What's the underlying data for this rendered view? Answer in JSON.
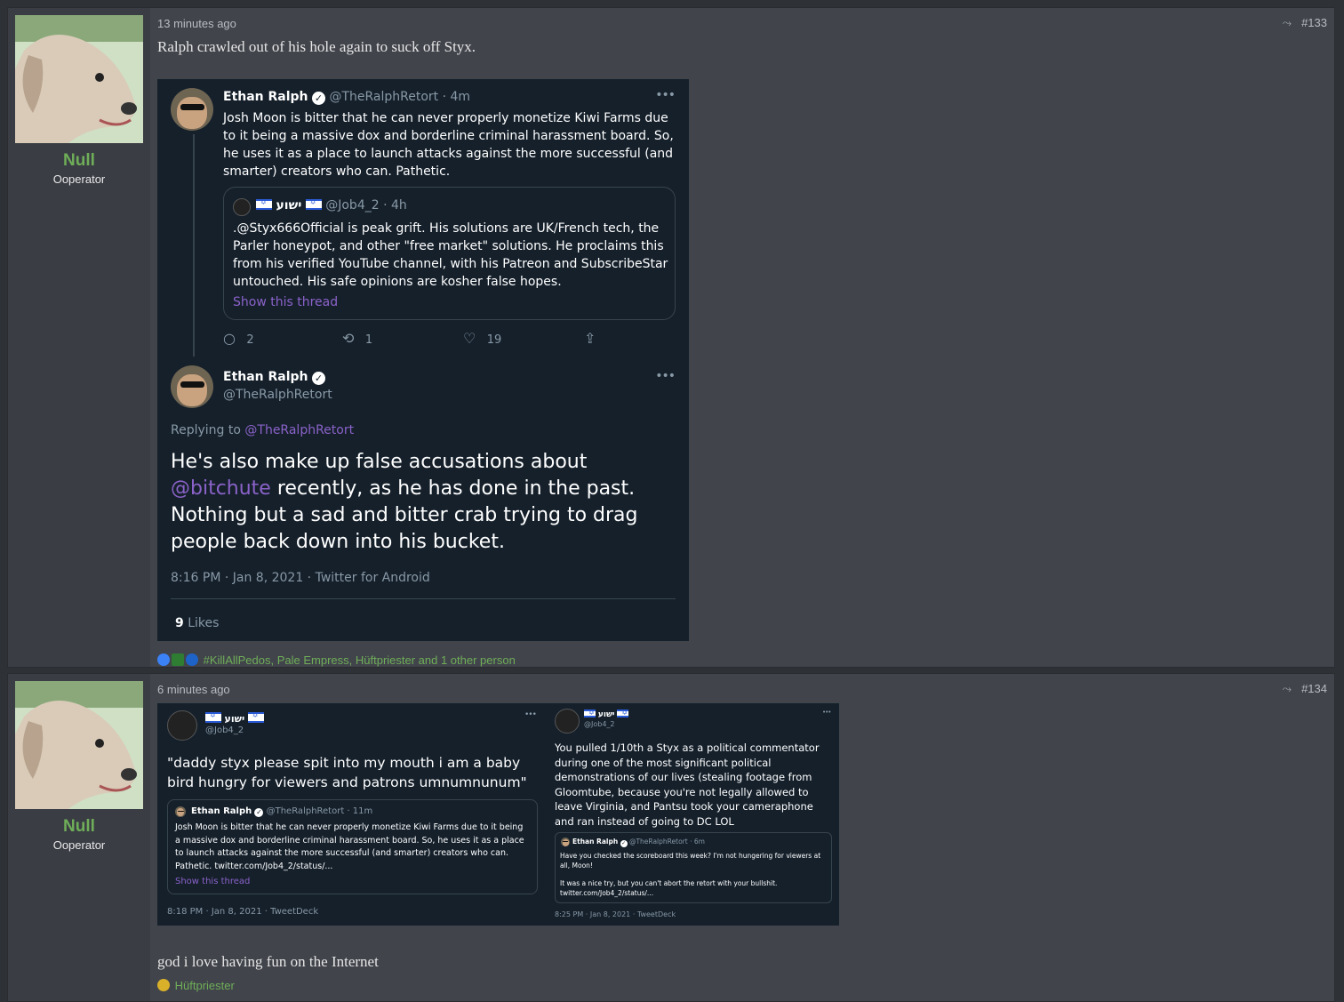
{
  "posts": [
    {
      "user": {
        "name": "Null",
        "title": "Ooperator"
      },
      "time": "13 minutes ago",
      "number": "#133",
      "message": "Ralph crawled out of his hole again to suck off Styx.",
      "tweet": {
        "author": "Ethan Ralph",
        "handle": "@TheRalphRetort",
        "age": "· 4m",
        "text": "Josh Moon is bitter that he can never properly monetize Kiwi Farms due to it being a massive dox and borderline criminal harassment board. So, he uses it as a place to launch attacks against the more successful (and smarter) creators who can. Pathetic.",
        "quote": {
          "name": "ישוע",
          "handle": "@Job4_2",
          "age": "· 4h",
          "text": ".@Styx666Official is peak grift. His solutions are UK/French tech, the Parler honeypot, and other \"free market\" solutions. He proclaims this from his verified YouTube channel, with his Patreon and SubscribeStar untouched. His safe opinions are kosher false hopes.",
          "show_thread": "Show this thread"
        },
        "replies": "2",
        "retweets": "1",
        "likes": "19",
        "reply": {
          "author": "Ethan Ralph",
          "handle": "@TheRalphRetort",
          "replying_label": "Replying to",
          "replying_handle": "@TheRalphRetort",
          "text_before": "He's also make up false accusations about ",
          "mention": "@bitchute",
          "text_after": " recently, as he has done in the past. Nothing but a sad and bitter crab trying to drag people back down into his bucket.",
          "timestamp": "8:16 PM · Jan 8, 2021 · Twitter for Android",
          "likes_count": "9",
          "likes_label": "Likes"
        }
      },
      "reactions": "#KillAllPedos, Pale Empress, Hüftpriester and 1 other person"
    },
    {
      "user": {
        "name": "Null",
        "title": "Ooperator"
      },
      "time": "6 minutes ago",
      "number": "#134",
      "left_tweet": {
        "name": "ישוע",
        "handle": "@Job4_2",
        "text": "\"daddy styx please spit into my mouth i am a baby bird hungry for viewers and patrons umnumnunum\"",
        "quote_author": "Ethan Ralph",
        "quote_handle": "@TheRalphRetort · 11m",
        "quote_text": "Josh Moon is bitter that he can never properly monetize Kiwi Farms due to it being a massive dox and borderline criminal harassment board. So, he uses it as a place to launch attacks against the more successful (and smarter) creators who can. Pathetic. twitter.com/Job4_2/status/...",
        "show_thread": "Show this thread",
        "timestamp": "8:18 PM · Jan 8, 2021 · TweetDeck"
      },
      "right_tweet": {
        "name": "ישוע",
        "handle": "@Job4_2",
        "text": "You pulled 1/10th a Styx as a political commentator during one of the most significant political demonstrations of our lives (stealing footage from Gloomtube, because you're not legally allowed to leave Virginia, and Pantsu took your cameraphone and ran instead of going to DC LOL",
        "quote_author": "Ethan Ralph",
        "quote_handle": "@TheRalphRetort · 6m",
        "quote_text1": "Have you checked the scoreboard this week? I'm not hungering for viewers at all, Moon!",
        "quote_text2": "It was a nice try, but you can't abort the retort with your bullshit. twitter.com/Job4_2/status/...",
        "timestamp": "8:25 PM · Jan 8, 2021 · TweetDeck"
      },
      "message": "god i love having fun on the Internet",
      "reactions": "Hüftpriester"
    }
  ],
  "colors": {
    "username": "#6fae58",
    "link": "#8b62c9",
    "tweet_bg": "#15202b"
  }
}
